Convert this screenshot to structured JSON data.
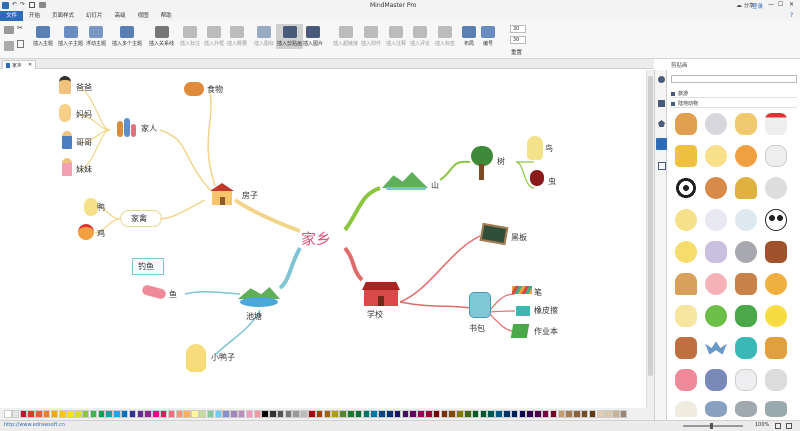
{
  "window": {
    "title": "MindMaster Pro"
  },
  "titlebar_right": {
    "share": "分享",
    "login": "登录"
  },
  "menu": [
    "文件",
    "开始",
    "页面样式",
    "幻灯片",
    "高级",
    "视图",
    "帮助"
  ],
  "ribbon": {
    "buttons": [
      {
        "label": "插入主题"
      },
      {
        "label": "插入子主题"
      },
      {
        "label": "浮动主题"
      },
      {
        "label": "插入多个主题"
      },
      {
        "label": "插入关系线"
      },
      {
        "label": "插入标注"
      },
      {
        "label": "插入外框"
      },
      {
        "label": "插入概要"
      },
      {
        "label": "插入图标"
      },
      {
        "label": "插入剪贴画"
      },
      {
        "label": "插入图片"
      },
      {
        "label": "插入超链接"
      },
      {
        "label": "插入附件"
      },
      {
        "label": "插入注释"
      },
      {
        "label": "插入评论"
      },
      {
        "label": "插入标签"
      },
      {
        "label": "布局"
      },
      {
        "label": "编号"
      }
    ],
    "spin1": "30",
    "spin2": "30",
    "reset": "重置"
  },
  "doc_tab": {
    "label": "家乡"
  },
  "mindmap": {
    "root": "家乡",
    "nodes": {
      "house": "房子",
      "food": "食物",
      "family": "家人",
      "dad": "爸爸",
      "mom": "妈妈",
      "brother": "哥哥",
      "sister": "妹妹",
      "poultry": "家禽",
      "duck": "鸭",
      "chicken": "鸡",
      "mountain": "山",
      "tree": "树",
      "bird": "鸟",
      "bug": "虫",
      "pond": "池塘",
      "fishing": "钓鱼",
      "fish": "鱼",
      "duckling": "小鸭子",
      "school": "学校",
      "blackboard": "黑板",
      "schoolbag": "书包",
      "pen": "笔",
      "eraser": "橡皮擦",
      "homework": "作业本"
    }
  },
  "clipart_panel": {
    "title": "剪贴画",
    "categories": [
      "旅游",
      "陆地动物"
    ]
  },
  "statusbar": {
    "url": "http://www.edrawsoft.cn",
    "zoom": "100%"
  },
  "colors": {
    "accent": "#2e6bb8",
    "root": "#e0507a",
    "house_branch": "#f2d58a",
    "mountain_branch": "#8cc63f",
    "pond_branch": "#7fc4d4",
    "school_branch": "#e06b6b"
  },
  "palette_colors": [
    "#ffffff",
    "#e6e6e6",
    "#c8102e",
    "#e8362b",
    "#f05a3a",
    "#f47c2a",
    "#f8a21c",
    "#fcc31b",
    "#ffe11a",
    "#d7e021",
    "#8cc63f",
    "#3cb54a",
    "#00a651",
    "#00a99d",
    "#00aeef",
    "#0072bc",
    "#2e3192",
    "#662d91",
    "#92278f",
    "#ec008c",
    "#ed145b",
    "#f26d7d",
    "#f69679",
    "#fbaf5d",
    "#fff799",
    "#c4df9b",
    "#82ca9c",
    "#6dcff6",
    "#8393ca",
    "#a186be",
    "#bd8cbf",
    "#f49ac1",
    "#f5989d",
    "#000000",
    "#333333",
    "#555555",
    "#777777",
    "#999999",
    "#bbbbbb",
    "#9e0b0f",
    "#a0410d",
    "#a36209",
    "#aba000",
    "#598527",
    "#197b30",
    "#007236",
    "#00746b",
    "#0076a3",
    "#004a80",
    "#003471",
    "#1b1464",
    "#440e62",
    "#630460",
    "#9e005d",
    "#9e0039",
    "#790000",
    "#7b2e00",
    "#7d4900",
    "#827b00",
    "#406618",
    "#005e20",
    "#005826",
    "#005952",
    "#005b7f",
    "#003663",
    "#002157",
    "#0d004c",
    "#32004b",
    "#4b0049",
    "#7b0046",
    "#7a0026",
    "#c69c6d",
    "#a67c52",
    "#8c6239",
    "#754c24",
    "#603913",
    "#e5ccb2",
    "#d7c9a9",
    "#c7b299",
    "#998675"
  ]
}
